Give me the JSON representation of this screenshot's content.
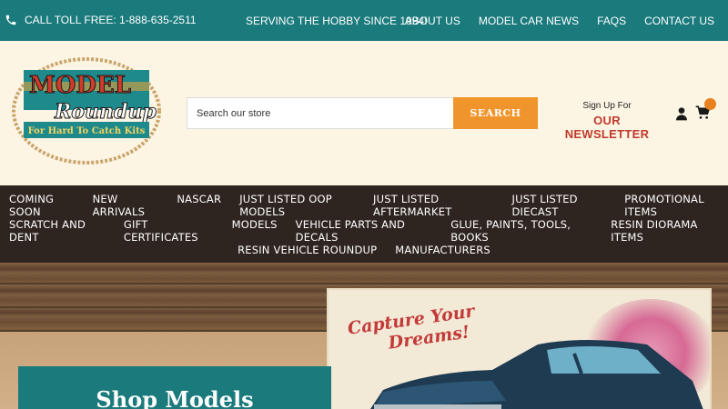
{
  "topbar": {
    "phone_text": "CALL TOLL FREE: 1-888-635-2511",
    "slogan": "SERVING THE HOBBY SINCE 1994!",
    "links": [
      "ABOUT US",
      "MODEL CAR NEWS",
      "FAQS",
      "CONTACT US"
    ]
  },
  "header": {
    "logo": {
      "line1": "MODEL",
      "line2": "Roundup",
      "line3": "For Hard To Catch Kits"
    },
    "search": {
      "placeholder": "Search our store",
      "button": "SEARCH"
    },
    "newsletter": {
      "small": "Sign Up For",
      "big": "OUR NEWSLETTER"
    },
    "icons": {
      "user": "user-icon",
      "cart": "cart-icon"
    }
  },
  "nav": {
    "row1": [
      "COMING SOON",
      "NEW ARRIVALS",
      "NASCAR",
      "JUST LISTED OOP MODELS",
      "JUST LISTED AFTERMARKET",
      "JUST LISTED DIECAST",
      "PROMOTIONAL ITEMS"
    ],
    "row2": [
      "SCRATCH AND DENT",
      "GIFT CERTIFICATES",
      "MODELS",
      "VEHICLE PARTS AND DECALS",
      "GLUE, PAINTS, TOOLS, BOOKS",
      "RESIN DIORAMA ITEMS"
    ],
    "row3": [
      "RESIN VEHICLE ROUNDUP",
      "MANUFACTURERS"
    ]
  },
  "hero": {
    "poster_tagline_1": "Capture Your",
    "poster_tagline_2": "Dreams!",
    "shop_title": "Shop Models"
  },
  "colors": {
    "teal": "#1a7a7c",
    "orange": "#f0952c",
    "nav_bg": "#2f2520",
    "cream": "#fdf5e4",
    "newsletter_red": "#c0392b"
  }
}
